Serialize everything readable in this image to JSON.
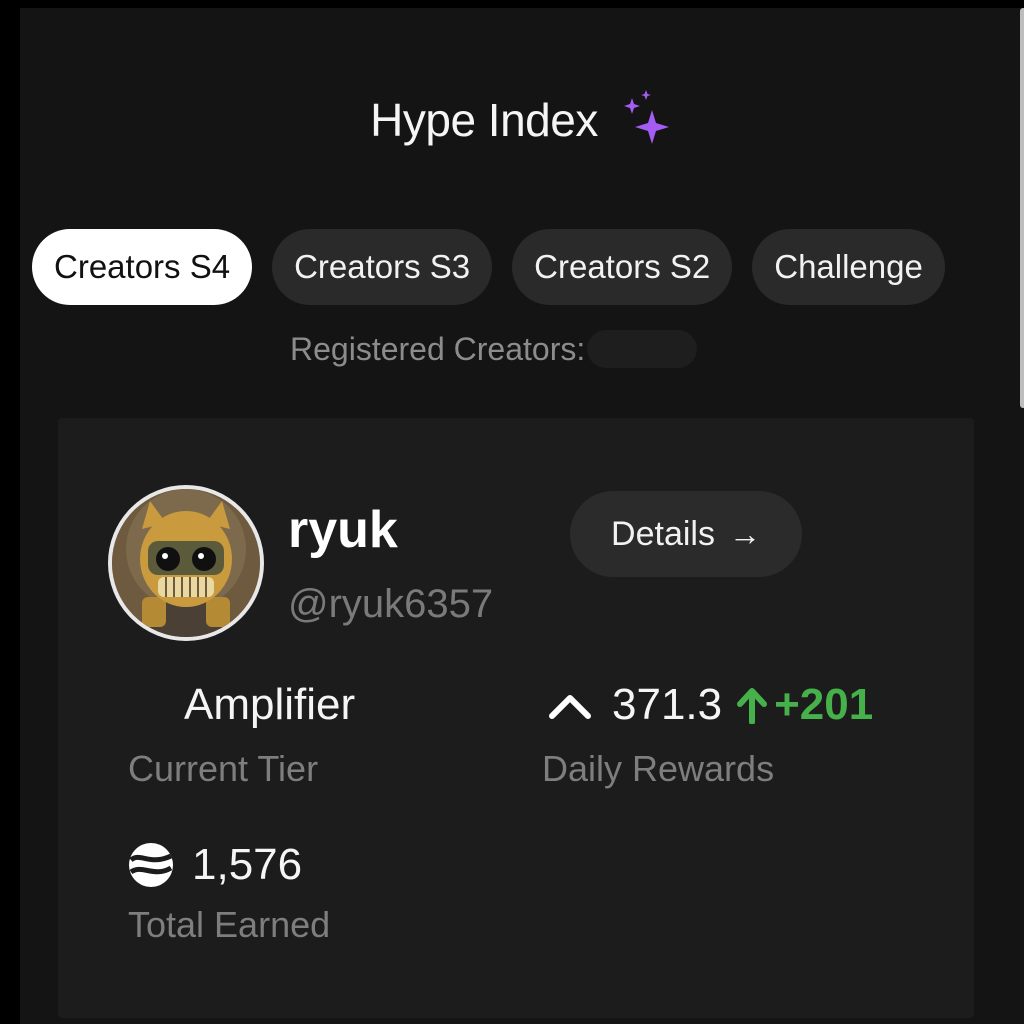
{
  "header": {
    "title": "Hype Index",
    "sparkle_icon": "sparkle-icon",
    "sparkle_color": "#a55cf5"
  },
  "tabs": [
    {
      "label": "Creators S4",
      "active": true
    },
    {
      "label": "Creators S3",
      "active": false
    },
    {
      "label": "Creators S2",
      "active": false
    },
    {
      "label": "Challenge",
      "active": false
    }
  ],
  "registered": {
    "label": "Registered Creators:"
  },
  "profile": {
    "name": "ryuk",
    "handle": "@ryuk6357",
    "details_label": "Details",
    "details_icon": "arrow-right-icon"
  },
  "stats": {
    "tier_value": "Amplifier",
    "tier_label": "Current Tier",
    "rewards_icon": "chevron-up-icon",
    "rewards_value": "371.3",
    "rewards_change": "+201",
    "rewards_change_color": "#46b04a",
    "rewards_label": "Daily Rewards",
    "earned_icon": "coin-icon",
    "earned_value": "1,576",
    "earned_label": "Total Earned"
  }
}
